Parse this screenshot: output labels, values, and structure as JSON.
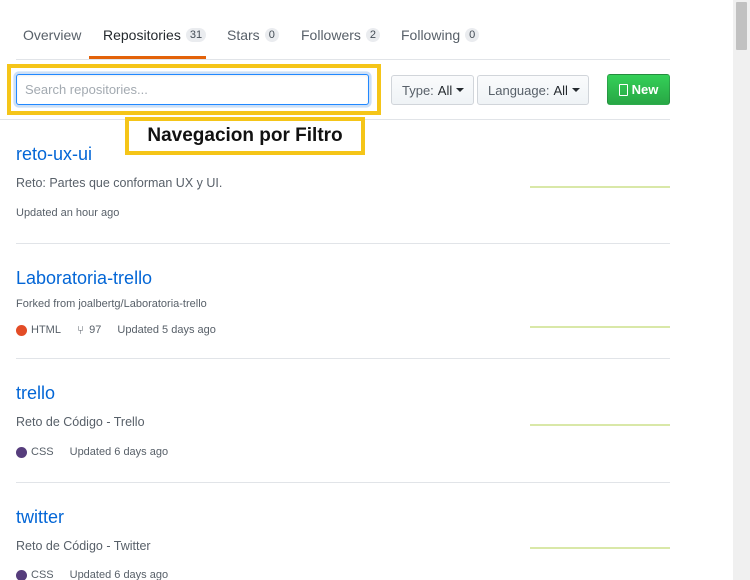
{
  "tabs": [
    {
      "label": "Overview",
      "count": null
    },
    {
      "label": "Repositories",
      "count": "31"
    },
    {
      "label": "Stars",
      "count": "0"
    },
    {
      "label": "Followers",
      "count": "2"
    },
    {
      "label": "Following",
      "count": "0"
    }
  ],
  "filter": {
    "search_placeholder": "Search repositories...",
    "type_label": "Type:",
    "type_value": "All",
    "language_label": "Language:",
    "language_value": "All",
    "new_label": "New"
  },
  "annotation": "Navegacion por Filtro",
  "repos": [
    {
      "name": "reto-ux-ui",
      "description": "Reto: Partes que conforman UX y UI.",
      "updated": "Updated an hour ago"
    },
    {
      "name": "Laboratoria-trello",
      "forked_from": "Forked from joalbertg/Laboratoria-trello",
      "language": "HTML",
      "language_color": "#e34c26",
      "forks": "97",
      "updated": "Updated 5 days ago"
    },
    {
      "name": "trello",
      "description": "Reto de Código - Trello",
      "language": "CSS",
      "language_color": "#563d7c",
      "updated": "Updated 6 days ago"
    },
    {
      "name": "twitter",
      "description": "Reto de Código - Twitter",
      "language": "CSS",
      "language_color": "#563d7c",
      "updated": "Updated 6 days ago"
    }
  ],
  "colors": {
    "accent": "#0366d6",
    "tab_underline": "#e36209",
    "new_button": "#28a745",
    "highlight": "#f5c518"
  }
}
